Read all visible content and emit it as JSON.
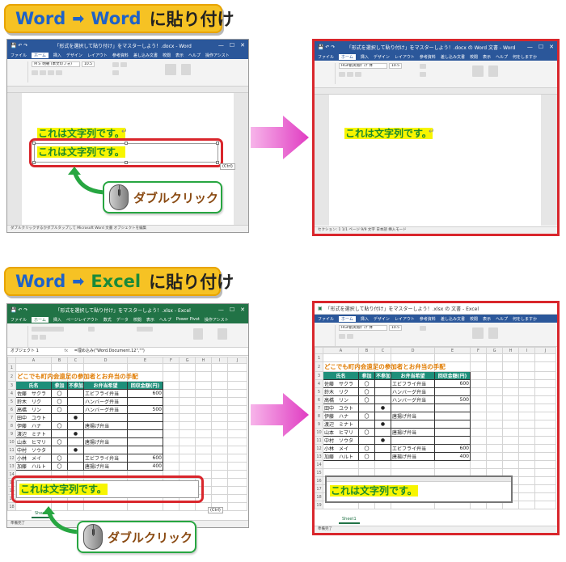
{
  "sections": {
    "word": {
      "b1": "Word",
      "b2": "Word",
      "suffix": "に貼り付け"
    },
    "excel": {
      "b1": "Word",
      "b2": "Excel",
      "suffix": "に貼り付け"
    }
  },
  "callout_label": "ダブルクリック",
  "pasted_text": "これは文字列です。",
  "word_before": {
    "title": "「形式を選択して貼り付け」をマスターしよう！.docx - Word",
    "tabs": [
      "ファイル",
      "ホーム",
      "挿入",
      "デザイン",
      "レイアウト",
      "参考資料",
      "差し込み文書",
      "校閲",
      "表示",
      "ヘルプ",
      "操作アシスト"
    ],
    "font": "ＭＳ 明朝 (本文のフォ)",
    "size": "10.5",
    "status": "ダブルクリックするかダブルタップして Microsoft Word 文書 オブジェクトを編集",
    "zoom": "100%"
  },
  "word_after": {
    "title": "「形式を選択して貼り付け」をマスターしよう！.docx の Word 文書 - Word",
    "tabs": [
      "ファイル",
      "ホーム",
      "挿入",
      "デザイン",
      "レイアウト",
      "参考資料",
      "差し込み文書",
      "校閲",
      "表示",
      "ヘルプ",
      "何をしますか"
    ],
    "font": "HGP創英角ﾎﾟｯﾌﾟ体",
    "size": "10.5",
    "status": "セクション: 1   1/1 ページ   9/9 文字   日本語   挿入モード",
    "zoom": "100%"
  },
  "excel_before": {
    "title": "「形式を選択して貼り付け」をマスターしよう！.xlsx - Excel",
    "tabs": [
      "ファイル",
      "ホーム",
      "挿入",
      "ページレイアウト",
      "数式",
      "データ",
      "校閲",
      "表示",
      "ヘルプ",
      "Power Pivot",
      "操作アシスト"
    ],
    "namebox": "オブジェクト 1",
    "formula": "=埋め込み(\"Word.Document.12\",\"\")",
    "sheet": "Sheet1",
    "status": "準備完了"
  },
  "excel_after": {
    "title": "「形式を選択して貼り付け」をマスターしよう！.xlsx の 文書 - Excel",
    "tabs": [
      "ファイル",
      "ホーム",
      "挿入",
      "デザイン",
      "レイアウト",
      "参考資料",
      "差し込み文書",
      "校閲",
      "表示",
      "ヘルプ",
      "何をしますか"
    ],
    "sheet": "Sheet1",
    "status": "準備完了"
  },
  "sheet_title": "どこでも町内会遠足の参加者とお弁当の手配",
  "sheet_headers": [
    "氏名",
    "参加",
    "不参加",
    "お弁当希望",
    "回収金額(円)"
  ],
  "sheet_rows": [
    {
      "name": "佐藤　サクラ",
      "join": "〇",
      "absent": "",
      "bento": "エビフライ弁当",
      "amount": "600"
    },
    {
      "name": "鈴木　リク",
      "join": "〇",
      "absent": "",
      "bento": "ハンバーグ弁当",
      "amount": ""
    },
    {
      "name": "高橋　リン",
      "join": "〇",
      "absent": "",
      "bento": "ハンバーグ弁当",
      "amount": "500"
    },
    {
      "name": "田中　ユウト",
      "join": "",
      "absent": "●",
      "bento": "",
      "amount": ""
    },
    {
      "name": "伊藤　ハナ",
      "join": "〇",
      "absent": "",
      "bento": "唐揚げ弁当",
      "amount": ""
    },
    {
      "name": "渡辺　ミナト",
      "join": "",
      "absent": "●",
      "bento": "",
      "amount": ""
    },
    {
      "name": "山本　ヒマリ",
      "join": "〇",
      "absent": "",
      "bento": "唐揚げ弁当",
      "amount": ""
    },
    {
      "name": "中村　ソウタ",
      "join": "",
      "absent": "●",
      "bento": "",
      "amount": ""
    },
    {
      "name": "小林　メイ",
      "join": "〇",
      "absent": "",
      "bento": "エビフライ弁当",
      "amount": "600"
    },
    {
      "name": "加藤　ハルト",
      "join": "〇",
      "absent": "",
      "bento": "唐揚げ弁当",
      "amount": "400"
    }
  ],
  "col_letters": [
    "A",
    "B",
    "C",
    "D",
    "E",
    "F",
    "G",
    "H",
    "I",
    "J"
  ],
  "paste_options": "(Ctrl)"
}
